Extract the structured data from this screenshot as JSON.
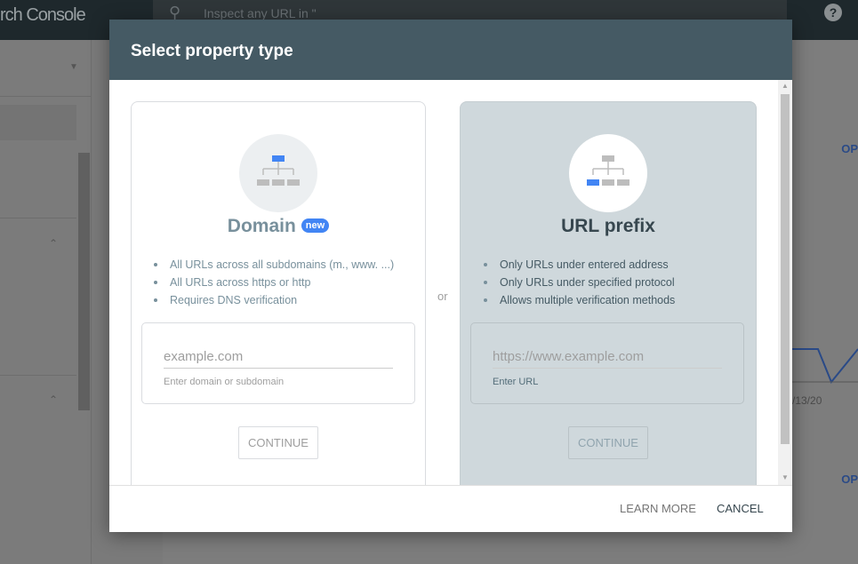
{
  "app": {
    "brand": "rch Console",
    "search_placeholder": "Inspect any URL in \"",
    "help": "?"
  },
  "background": {
    "op1": "OP",
    "op2": "OP",
    "date": "/13/20"
  },
  "dialog": {
    "title": "Select property type",
    "or": "or",
    "domain": {
      "title": "Domain",
      "badge": "new",
      "bullets": [
        "All URLs across all subdomains (m., www. ...)",
        "All URLs across https or http",
        "Requires DNS verification"
      ],
      "placeholder": "example.com",
      "hint": "Enter domain or subdomain",
      "continue": "CONTINUE",
      "icon": "sitemap-icon"
    },
    "url_prefix": {
      "title": "URL prefix",
      "bullets": [
        "Only URLs under entered address",
        "Only URLs under specified protocol",
        "Allows multiple verification methods"
      ],
      "placeholder": "https://www.example.com",
      "hint": "Enter URL",
      "continue": "CONTINUE",
      "icon": "sitemap-icon"
    },
    "footer": {
      "learn_more": "LEARN MORE",
      "cancel": "CANCEL"
    }
  },
  "colors": {
    "header": "#455a64",
    "accent": "#4285f4",
    "selected_card": "#cfd8dc"
  }
}
